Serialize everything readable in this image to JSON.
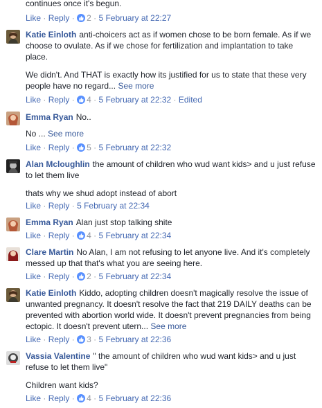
{
  "top_partial": {
    "text": "continues once it's begun.",
    "actions": {
      "like": "Like",
      "reply": "Reply",
      "likes": "2",
      "time": "5 February at 22:27",
      "edited": ""
    }
  },
  "comments": [
    {
      "author": "Katie Einloth",
      "text": "anti-choicers act as if women chose to be born female. As if we choose to ovulate. As if we chose for fertilization and implantation to take place.",
      "para2": "We didn't. And THAT is exactly how its justified for us to state that these very people have no regard...",
      "see_more": "See more",
      "actions": {
        "like": "Like",
        "reply": "Reply",
        "likes": "4",
        "time": "5 February at 22:32",
        "edited": "Edited"
      }
    },
    {
      "author": "Emma Ryan",
      "text": "No..",
      "para2": "No ...",
      "see_more": "See more",
      "actions": {
        "like": "Like",
        "reply": "Reply",
        "likes": "5",
        "time": "5 February at 22:32",
        "edited": ""
      }
    },
    {
      "author": "Alan Mcloughlin",
      "text": "the amount of children who wud want kids> and u just refuse to let them live",
      "para2": "thats why we shud adopt instead of abort",
      "see_more": "",
      "actions": {
        "like": "Like",
        "reply": "Reply",
        "likes": "",
        "time": "5 February at 22:34",
        "edited": ""
      }
    },
    {
      "author": "Emma Ryan",
      "text": "Alan just stop talking shite",
      "para2": "",
      "see_more": "",
      "actions": {
        "like": "Like",
        "reply": "Reply",
        "likes": "4",
        "time": "5 February at 22:34",
        "edited": ""
      }
    },
    {
      "author": "Clare Martin",
      "text": "No Alan, I am not refusing to let anyone live. And it's completely messed up that that's what you are seeing here.",
      "para2": "",
      "see_more": "",
      "actions": {
        "like": "Like",
        "reply": "Reply",
        "likes": "2",
        "time": "5 February at 22:34",
        "edited": ""
      }
    },
    {
      "author": "Katie Einloth",
      "text": "Kiddo, adopting children doesn't magically resolve the issue of unwanted pregnancy. It doesn't resolve the fact that 219 DAILY deaths can be prevented with abortion world wide. It doesn't prevent pregnancies from being ectopic. It doesn't prevent utern...",
      "para2": "",
      "see_more": "See more",
      "actions": {
        "like": "Like",
        "reply": "Reply",
        "likes": "3",
        "time": "5 February at 22:36",
        "edited": ""
      }
    },
    {
      "author": "Vassia Valentine",
      "text": "\" the amount of children who wud want kids> and u just refuse to let them live\"",
      "para2": "Children want kids?",
      "see_more": "",
      "actions": {
        "like": "Like",
        "reply": "Reply",
        "likes": "4",
        "time": "5 February at 22:36",
        "edited": ""
      }
    }
  ],
  "separator": "·",
  "colors": {
    "link": "#365899",
    "meta": "#90949c",
    "like_badge": "#5890ff"
  }
}
